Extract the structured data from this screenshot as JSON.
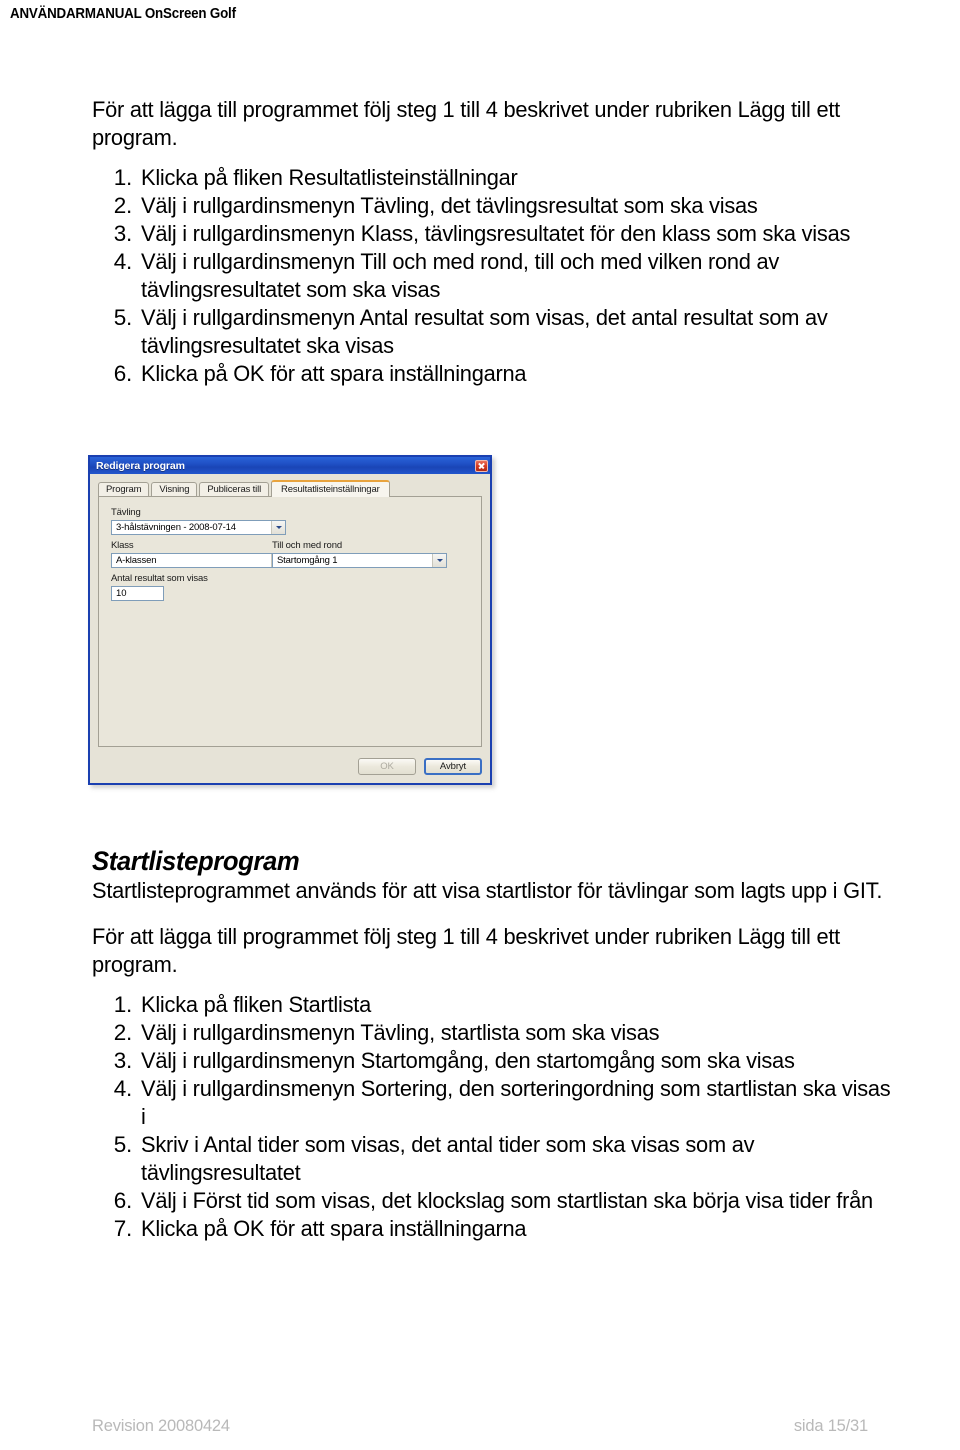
{
  "header": {
    "title": "ANVÄNDARMANUAL OnScreen Golf"
  },
  "section_one": {
    "intro": "För att lägga till programmet följ steg 1 till 4 beskrivet under rubriken Lägg till ett program.",
    "steps": [
      {
        "num": "1.",
        "text": "Klicka på fliken Resultatlisteinställningar"
      },
      {
        "num": "2.",
        "text": "Välj i rullgardinsmenyn Tävling, det tävlingsresultat som ska visas"
      },
      {
        "num": "3.",
        "text": "Välj i rullgardinsmenyn Klass, tävlingsresultatet för den klass som ska visas"
      },
      {
        "num": "4.",
        "text": "Välj i rullgardinsmenyn Till och med rond, till och med vilken rond av tävlingsresultatet som ska visas"
      },
      {
        "num": "5.",
        "text": "Välj i rullgardinsmenyn Antal resultat som visas, det antal resultat som av tävlingsresultatet ska visas"
      },
      {
        "num": "6.",
        "text": "Klicka på OK för att spara inställningarna"
      }
    ]
  },
  "dialog": {
    "title": "Redigera program",
    "close_label": "Stäng",
    "tabs": [
      {
        "label": "Program",
        "active": false
      },
      {
        "label": "Visning",
        "active": false
      },
      {
        "label": "Publiceras till",
        "active": false
      },
      {
        "label": "Resultatlisteinställningar",
        "active": true
      }
    ],
    "fields": {
      "tavling_label": "Tävling",
      "tavling_value": "3-hålstävningen - 2008-07-14",
      "klass_label": "Klass",
      "klass_value": "A-klassen",
      "rond_label": "Till och med rond",
      "rond_value": "Startomgång 1",
      "antal_label": "Antal resultat som visas",
      "antal_value": "10"
    },
    "buttons": {
      "ok_label": "OK",
      "cancel_label": "Avbryt"
    }
  },
  "section_two": {
    "heading": "Startlisteprogram",
    "description": "Startlisteprogrammet används för att visa startlistor för tävlingar som lagts upp i GIT.",
    "intro": "För att lägga till programmet följ steg 1 till 4 beskrivet under rubriken Lägg till ett program.",
    "steps": [
      {
        "num": "1.",
        "text": "Klicka på fliken Startlista"
      },
      {
        "num": "2.",
        "text": "Välj i rullgardinsmenyn Tävling, startlista som ska visas"
      },
      {
        "num": "3.",
        "text": "Välj i rullgardinsmenyn Startomgång, den startomgång som ska visas"
      },
      {
        "num": "4.",
        "text": "Välj i rullgardinsmenyn Sortering, den sorteringordning som startlistan ska visas i"
      },
      {
        "num": "5.",
        "text": "Skriv i Antal tider som visas, det antal tider som ska visas som av tävlingsresultatet"
      },
      {
        "num": "6.",
        "text": "Välj i Först tid som visas, det klockslag som startlistan ska börja visa tider från"
      },
      {
        "num": "7.",
        "text": "Klicka på OK för att spara inställningarna"
      }
    ]
  },
  "footer": {
    "revision": "Revision 20080424",
    "page": "sida 15/31"
  }
}
